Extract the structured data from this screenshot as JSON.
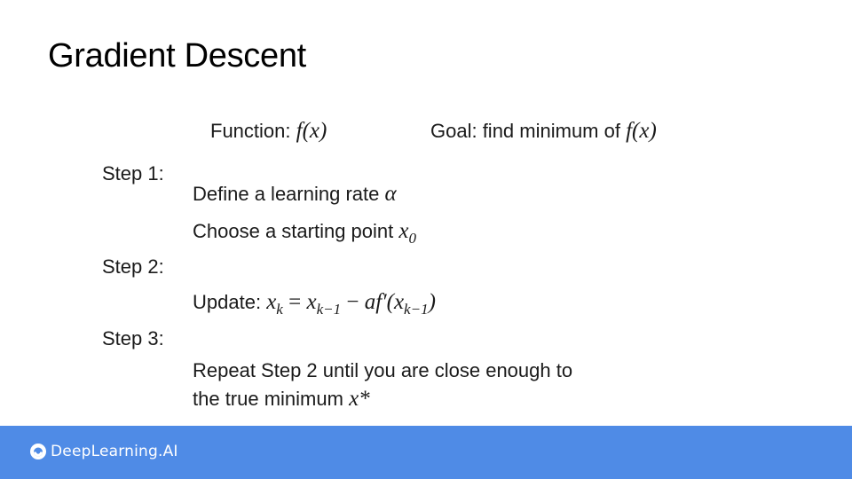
{
  "slide": {
    "title": "Gradient Descent",
    "function_label": "Function:",
    "function_expr": "f(x)",
    "goal_label": "Goal: find minimum of",
    "goal_expr": "f(x)",
    "step1": {
      "label": "Step 1:",
      "line1_text": "Define a learning rate",
      "line1_symbol": "α",
      "line2_text": "Choose a starting point",
      "line2_symbol": "x",
      "line2_sub": "0"
    },
    "step2": {
      "label": "Step 2:",
      "update_label": "Update:",
      "lhs": "x",
      "lhs_sub": "k",
      "eq": "=",
      "rhs_x": "x",
      "rhs_x_sub": "k−1",
      "minus": "−",
      "af": "af",
      "prime": "′",
      "paren_open": "(x",
      "inner_sub": "k−1",
      "paren_close": ")"
    },
    "step3": {
      "label": "Step 3:",
      "line1": "Repeat Step 2 until you are close enough to",
      "line2_text": "the true minimum",
      "line2_symbol": "x*"
    }
  },
  "footer": {
    "brand": "DeepLearning.AI",
    "logo_icon": "deeplearning-ai-logo-icon",
    "background_color": "#4f8be6"
  }
}
